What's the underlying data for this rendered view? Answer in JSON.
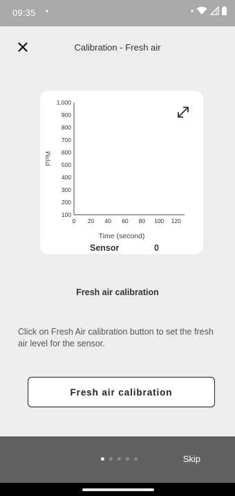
{
  "status_bar": {
    "time": "09:35",
    "notification_dot": "•",
    "icons": [
      "dot-icon",
      "wifi-icon",
      "signal-icon",
      "battery-icon"
    ]
  },
  "header": {
    "title": "Calibration - Fresh air",
    "close_icon": "close-icon"
  },
  "chart": {
    "expand_icon": "expand-icon",
    "readout_label": "Sensor",
    "readout_value": "0"
  },
  "chart_data": {
    "type": "line",
    "title": "",
    "xlabel": "Time (second)",
    "ylabel": "PPM",
    "x_ticks": [
      "0",
      "20",
      "40",
      "60",
      "80",
      "100",
      "120"
    ],
    "y_ticks": [
      "100",
      "200",
      "300",
      "400",
      "500",
      "600",
      "700",
      "800",
      "900",
      "1,000"
    ],
    "xlim": [
      0,
      130
    ],
    "ylim": [
      100,
      1000
    ],
    "series": [],
    "grid": false
  },
  "content": {
    "heading": "Fresh air calibration",
    "instructions": "Click on Fresh Air calibration button to set the fresh air level for the sensor.",
    "button_label": "Fresh air calibration"
  },
  "footer": {
    "page_count": 5,
    "active_page": 1,
    "skip_label": "Skip"
  },
  "colors": {
    "background": "#ededed",
    "status_bar": "#a9a9a9",
    "bottom_bar": "#616161",
    "card": "#ffffff"
  }
}
